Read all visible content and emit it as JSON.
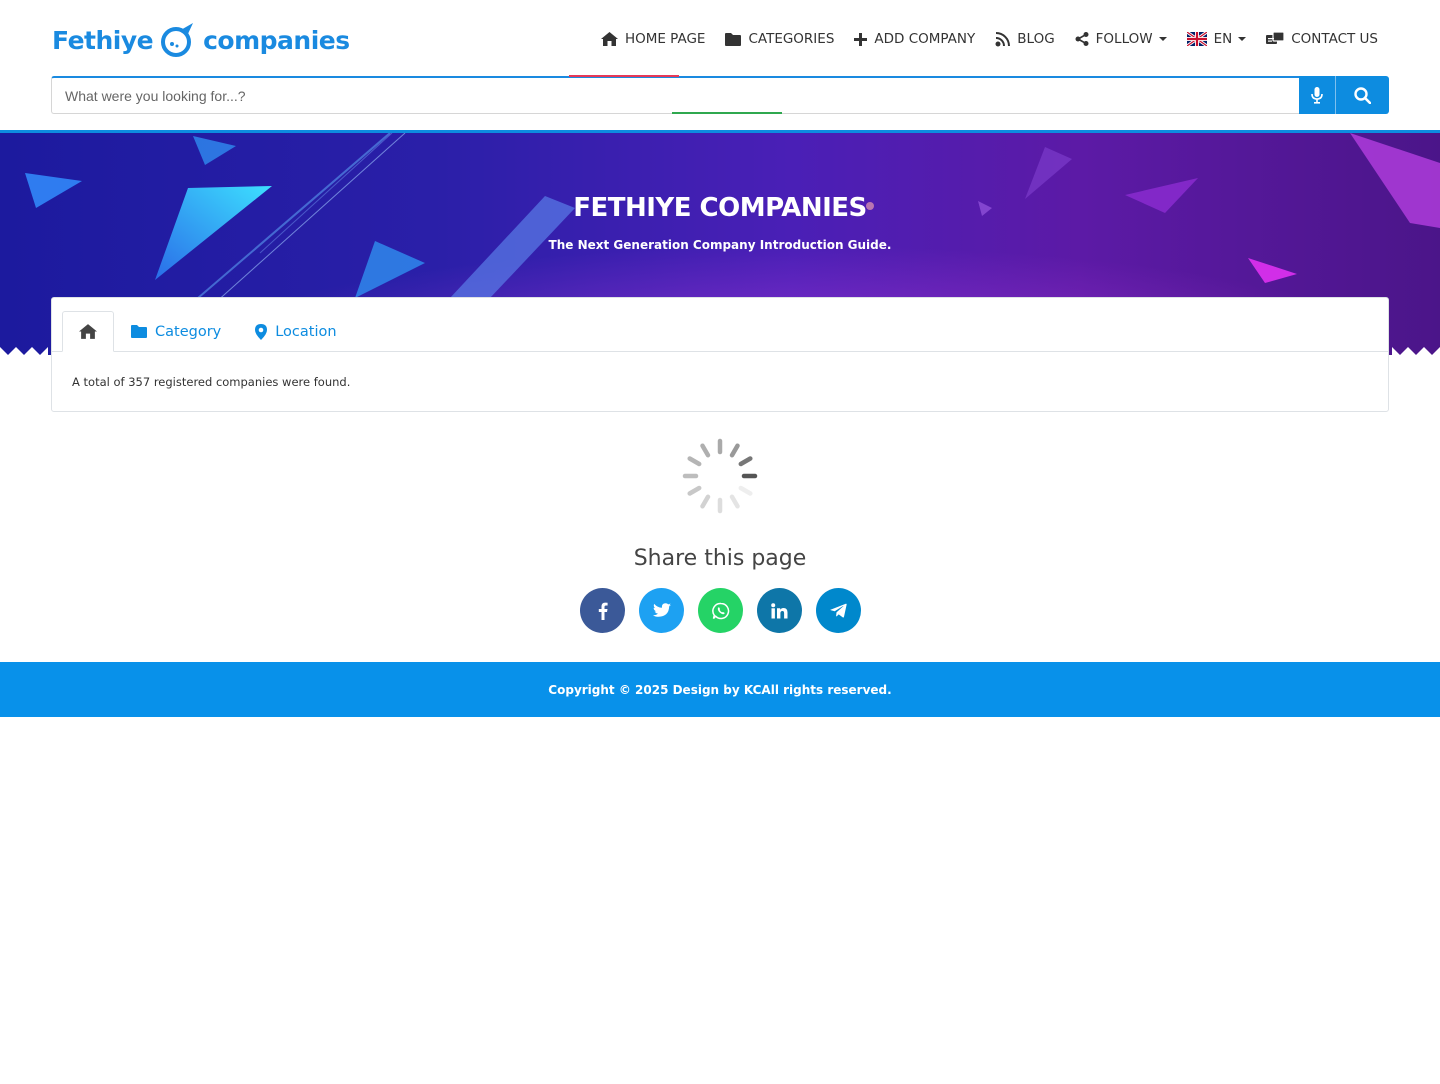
{
  "brand": {
    "name_left": "Fethiye",
    "name_right": "companies",
    "color": "#1a8ae0"
  },
  "nav": {
    "items": [
      {
        "label": "HOME PAGE",
        "icon": "home-icon"
      },
      {
        "label": "CATEGORIES",
        "icon": "folder-icon"
      },
      {
        "label": "ADD COMPANY",
        "icon": "plus-icon"
      },
      {
        "label": "BLOG",
        "icon": "blog-icon"
      },
      {
        "label": "FOLLOW",
        "icon": "share-icon",
        "dropdown": true
      },
      {
        "label": "EN",
        "icon": "uk-flag-icon",
        "dropdown": true
      },
      {
        "label": "CONTACT US",
        "icon": "contact-icon"
      }
    ]
  },
  "search": {
    "placeholder": "What were you looking for...?",
    "value": ""
  },
  "hero": {
    "title": "FETHIYE COMPANIES",
    "subtitle": "The Next Generation Company Introduction Guide."
  },
  "tabs": [
    {
      "label": "",
      "icon": "home-icon",
      "active": true
    },
    {
      "label": "Category",
      "icon": "folder-icon",
      "active": false
    },
    {
      "label": "Location",
      "icon": "map-pin-icon",
      "active": false
    }
  ],
  "results": {
    "text": "A total of 357 registered companies were found."
  },
  "share": {
    "title": "Share this page",
    "buttons": [
      {
        "network": "facebook",
        "icon": "facebook-icon",
        "color": "#3b5998"
      },
      {
        "network": "twitter",
        "icon": "twitter-icon",
        "color": "#1da1f2"
      },
      {
        "network": "whatsapp",
        "icon": "whatsapp-icon",
        "color": "#25d366"
      },
      {
        "network": "linkedin",
        "icon": "linkedin-icon",
        "color": "#0e76a8"
      },
      {
        "network": "telegram",
        "icon": "telegram-icon",
        "color": "#0088cc"
      }
    ]
  },
  "footer": {
    "text": "Copyright © 2025 Design by KCAll rights reserved."
  },
  "colors": {
    "primary": "#0d8ce0",
    "footer_bg": "#0891ea",
    "hero_start": "#1c1a9e",
    "hero_end": "#4b1589"
  }
}
